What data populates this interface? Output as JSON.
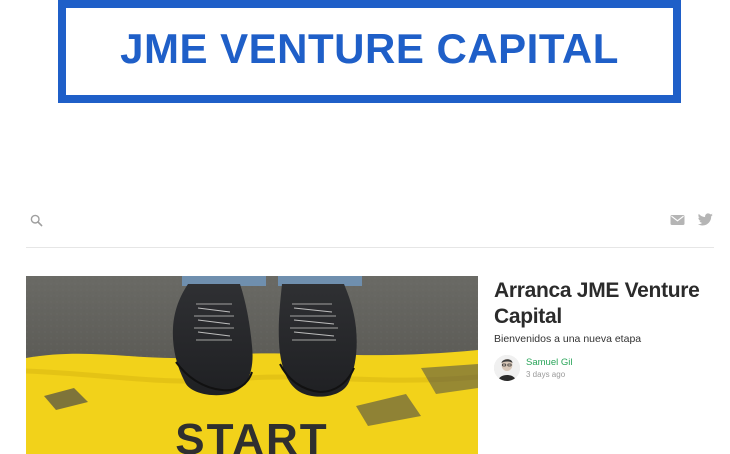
{
  "brand": {
    "logo_text": "JME VENTURE CAPITAL",
    "color": "#1f5fc8"
  },
  "toolbar": {
    "search_icon": "search-icon",
    "mail_icon": "mail-icon",
    "twitter_icon": "twitter-icon",
    "icon_color": "#b5b5b5"
  },
  "featured_post": {
    "image": {
      "subject": "sneakers-on-start-line",
      "text": "START"
    },
    "title": "Arranca JME Venture Capital",
    "subtitle": "Bienvenidos a una nueva etapa",
    "author": {
      "name": "Samuel Gil",
      "time": "3 days ago",
      "name_color": "#2aa55a"
    }
  }
}
